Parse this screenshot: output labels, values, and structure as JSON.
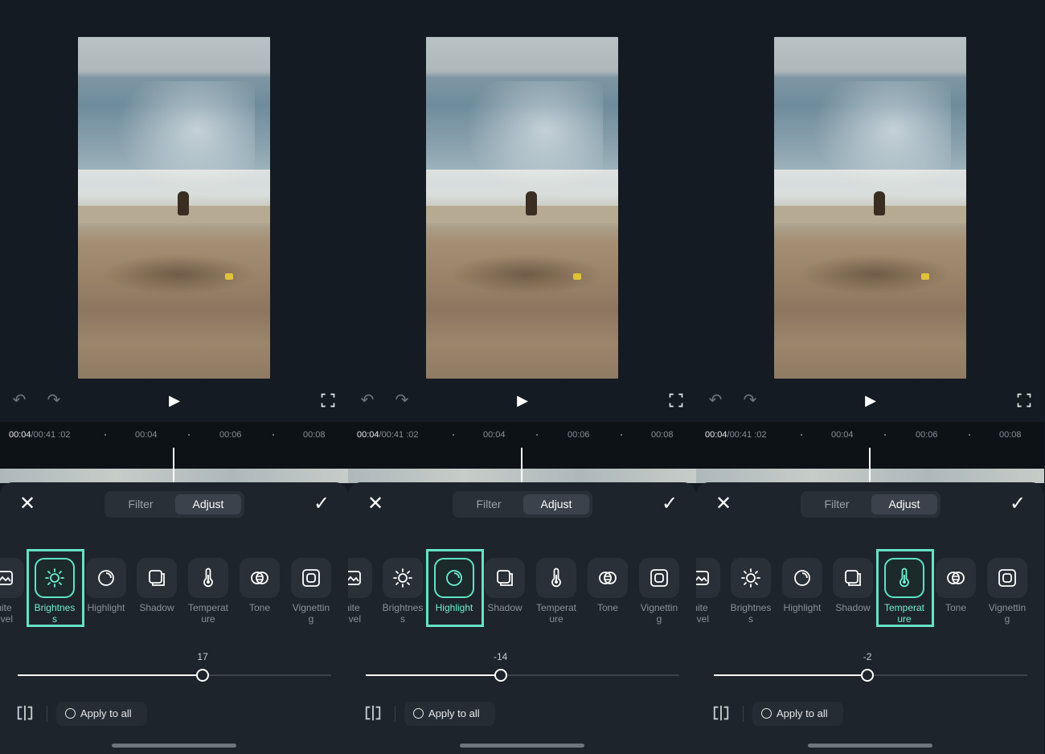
{
  "panels": [
    {
      "time_current": "00:04",
      "time_total": "/00:41",
      "time_frac": ":02",
      "ticks": [
        "00:04",
        "00:06",
        "00:08"
      ],
      "tabs": {
        "filter": "Filter",
        "adjust": "Adjust"
      },
      "tools": [
        {
          "label": "hite\nevel",
          "icon": "white-level-icon"
        },
        {
          "label": "Brightnes\ns",
          "icon": "sun-icon"
        },
        {
          "label": "Highlight",
          "icon": "highlight-icon"
        },
        {
          "label": "Shadow",
          "icon": "shadow-icon"
        },
        {
          "label": "Temperat\nure",
          "icon": "thermometer-icon"
        },
        {
          "label": "Tone",
          "icon": "tone-icon"
        },
        {
          "label": "Vignettin\ng",
          "icon": "vignette-icon"
        }
      ],
      "active_tool_index": 1,
      "slider_value": "17",
      "slider_fraction": 0.59,
      "apply_label": "Apply to all"
    },
    {
      "time_current": "00:04",
      "time_total": "/00:41",
      "time_frac": ":02",
      "ticks": [
        "00:04",
        "00:06",
        "00:08"
      ],
      "tabs": {
        "filter": "Filter",
        "adjust": "Adjust"
      },
      "tools": [
        {
          "label": "hite\nevel",
          "icon": "white-level-icon"
        },
        {
          "label": "Brightnes\ns",
          "icon": "sun-icon"
        },
        {
          "label": "Highlight",
          "icon": "highlight-icon"
        },
        {
          "label": "Shadow",
          "icon": "shadow-icon"
        },
        {
          "label": "Temperat\nure",
          "icon": "thermometer-icon"
        },
        {
          "label": "Tone",
          "icon": "tone-icon"
        },
        {
          "label": "Vignettin\ng",
          "icon": "vignette-icon"
        }
      ],
      "active_tool_index": 2,
      "slider_value": "-14",
      "slider_fraction": 0.43,
      "apply_label": "Apply to all"
    },
    {
      "time_current": "00:04",
      "time_total": "/00:41",
      "time_frac": ":02",
      "ticks": [
        "00:04",
        "00:06",
        "00:08"
      ],
      "tabs": {
        "filter": "Filter",
        "adjust": "Adjust"
      },
      "tools": [
        {
          "label": "hite\nevel",
          "icon": "white-level-icon"
        },
        {
          "label": "Brightnes\ns",
          "icon": "sun-icon"
        },
        {
          "label": "Highlight",
          "icon": "highlight-icon"
        },
        {
          "label": "Shadow",
          "icon": "shadow-icon"
        },
        {
          "label": "Temperat\nure",
          "icon": "thermometer-icon"
        },
        {
          "label": "Tone",
          "icon": "tone-icon"
        },
        {
          "label": "Vignettin\ng",
          "icon": "vignette-icon"
        }
      ],
      "active_tool_index": 4,
      "slider_value": "-2",
      "slider_fraction": 0.49,
      "apply_label": "Apply to all"
    }
  ],
  "colors": {
    "accent": "#5ee3c5",
    "highlight_box": "#66e1c6",
    "sheet": "#1e242b",
    "background": "#141b22"
  }
}
